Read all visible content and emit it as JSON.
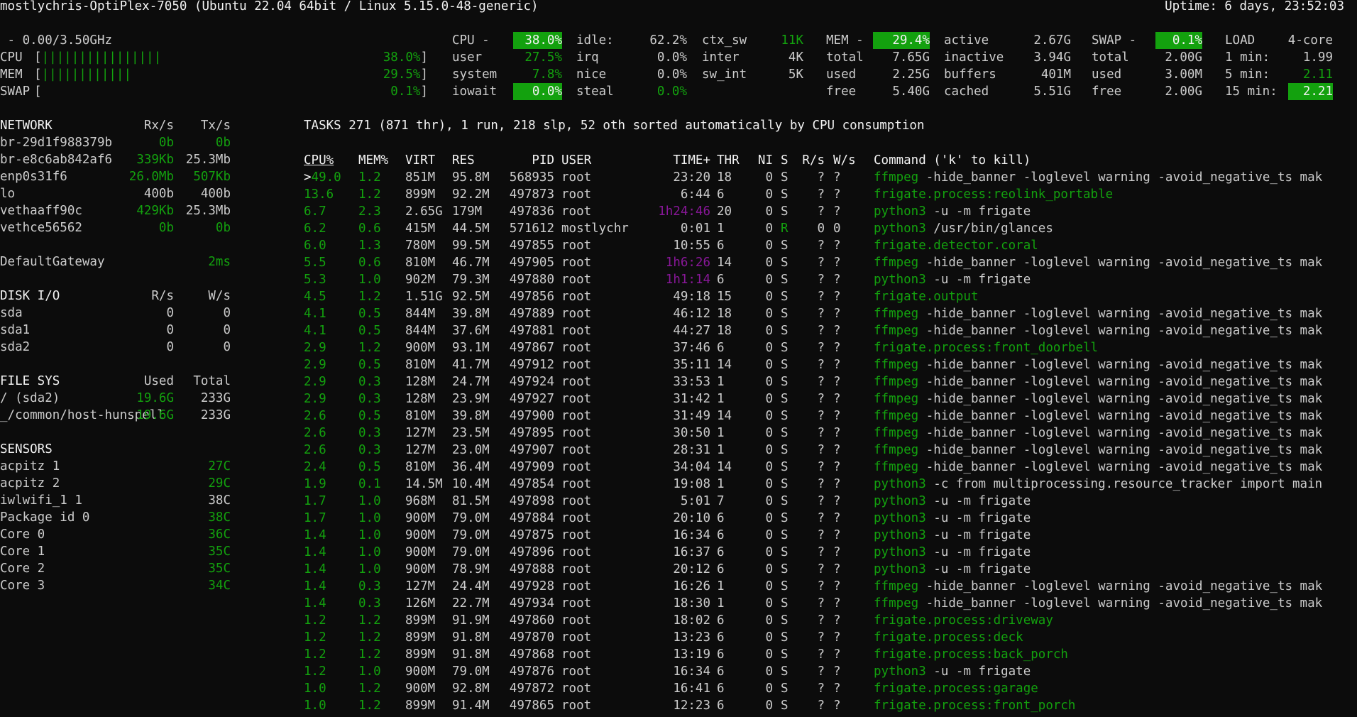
{
  "header": {
    "host": "mostlychris-OptiPlex-7050 (Ubuntu 22.04 64bit / Linux 5.15.0-48-generic)",
    "uptime": "Uptime: 6 days, 23:52:03"
  },
  "quicklook": {
    "freq": " - 0.00/3.50GHz",
    "cpu_label": "CPU",
    "cpu_bar": "[||||||||||||||||",
    "cpu_pct": "38.0%]",
    "mem_label": "MEM",
    "mem_bar": "[||||||||||||",
    "mem_pct": "29.5%]",
    "swap_label": "SWAP",
    "swap_bar": "[",
    "swap_pct": "0.1%]"
  },
  "cpu": {
    "title": "CPU -",
    "total": "38.0%",
    "rows": [
      {
        "k": "user",
        "v": "27.5%"
      },
      {
        "k": "system",
        "v": "7.8%"
      },
      {
        "k": "iowait",
        "v": "0.0%"
      }
    ],
    "rows2": [
      {
        "k": "idle:",
        "v": "62.2%"
      },
      {
        "k": "irq",
        "v": "0.0%"
      },
      {
        "k": "nice",
        "v": "0.0%"
      },
      {
        "k": "steal",
        "v": "0.0%"
      }
    ],
    "rows3": [
      {
        "k": "ctx_sw",
        "v": "11K"
      },
      {
        "k": "inter",
        "v": "4K"
      },
      {
        "k": "sw_int",
        "v": "5K"
      }
    ]
  },
  "mem": {
    "title": "MEM -",
    "total_pct": "29.4%",
    "rows": [
      {
        "k": "total",
        "v": "7.65G"
      },
      {
        "k": "used",
        "v": "2.25G"
      },
      {
        "k": "free",
        "v": "5.40G"
      }
    ],
    "rows2": [
      {
        "k": "active",
        "v": "2.67G"
      },
      {
        "k": "inactive",
        "v": "3.94G"
      },
      {
        "k": "buffers",
        "v": "401M"
      },
      {
        "k": "cached",
        "v": "5.51G"
      }
    ]
  },
  "swap": {
    "title": "SWAP -",
    "total_pct": "0.1%",
    "rows": [
      {
        "k": "total",
        "v": "2.00G"
      },
      {
        "k": "used",
        "v": "3.00M"
      },
      {
        "k": "free",
        "v": "2.00G"
      }
    ]
  },
  "load": {
    "title": "LOAD",
    "cores": "4-core",
    "rows": [
      {
        "k": "1 min:",
        "v": "1.99"
      },
      {
        "k": "5 min:",
        "v": "2.11"
      },
      {
        "k": "15 min:",
        "v": "2.21"
      }
    ]
  },
  "network": {
    "title": "NETWORK",
    "rx_h": "Rx/s",
    "tx_h": "Tx/s",
    "rows": [
      {
        "name": "br-29d1f988379b",
        "rx": "0b",
        "tx": "0b"
      },
      {
        "name": "br-e8c6ab842af6",
        "rx": "339Kb",
        "tx": "25.3Mb"
      },
      {
        "name": "enp0s31f6",
        "rx": "26.0Mb",
        "tx": "507Kb"
      },
      {
        "name": "lo",
        "rx": "400b",
        "tx": "400b"
      },
      {
        "name": "vethaaff90c",
        "rx": "429Kb",
        "tx": "25.3Mb"
      },
      {
        "name": "vethce56562",
        "rx": "0b",
        "tx": "0b"
      }
    ],
    "gateway_label": "DefaultGateway",
    "gateway_value": "2ms"
  },
  "diskio": {
    "title": "DISK I/O",
    "r_h": "R/s",
    "w_h": "W/s",
    "rows": [
      {
        "name": "sda",
        "r": "0",
        "w": "0"
      },
      {
        "name": "sda1",
        "r": "0",
        "w": "0"
      },
      {
        "name": "sda2",
        "r": "0",
        "w": "0"
      }
    ]
  },
  "fs": {
    "title": "FILE SYS",
    "used_h": "Used",
    "total_h": "Total",
    "rows": [
      {
        "name": "/ (sda2)",
        "used": "19.6G",
        "total": "233G"
      },
      {
        "name": "_/common/host-hunspell",
        "used": "19.6G",
        "total": "233G"
      }
    ]
  },
  "sensors": {
    "title": "SENSORS",
    "rows": [
      {
        "name": "acpitz 1",
        "v": "27C",
        "g": true
      },
      {
        "name": "acpitz 2",
        "v": "29C",
        "g": true
      },
      {
        "name": "iwlwifi_1 1",
        "v": "38C",
        "g": false
      },
      {
        "name": "Package id 0",
        "v": "38C",
        "g": true
      },
      {
        "name": "Core 0",
        "v": "36C",
        "g": true
      },
      {
        "name": "Core 1",
        "v": "35C",
        "g": true
      },
      {
        "name": "Core 2",
        "v": "35C",
        "g": true
      },
      {
        "name": "Core 3",
        "v": "34C",
        "g": true
      }
    ]
  },
  "tasks": {
    "summary": "TASKS 271 (871 thr), 1 run, 218 slp, 52 oth sorted automatically by CPU consumption",
    "headers": {
      "cpu": "CPU%",
      "mem": "MEM%",
      "virt": "VIRT",
      "res": "RES",
      "pid": "PID",
      "user": "USER",
      "time": "TIME+",
      "thr": "THR",
      "ni": "NI",
      "s": "S",
      "rs": "R/s",
      "ws": "W/s",
      "cmd": "Command ('k' to kill)"
    }
  },
  "processes": [
    {
      "cpu": ">49.0",
      "mem": "1.2",
      "virt": "851M",
      "res": "95.8M",
      "pid": "568935",
      "user": "root",
      "time": "23:20",
      "tm": false,
      "thr": "18",
      "ni": "0",
      "s": "S",
      "rs": "?",
      "ws": "?",
      "exe": "ffmpeg",
      "args": " -hide_banner -loglevel warning -avoid_negative_ts mak"
    },
    {
      "cpu": "13.6",
      "mem": "1.2",
      "virt": "899M",
      "res": "92.2M",
      "pid": "497873",
      "user": "root",
      "time": "6:44",
      "tm": false,
      "thr": "6",
      "ni": "0",
      "s": "S",
      "rs": "?",
      "ws": "?",
      "exe": "frigate.process:reolink_portable",
      "args": ""
    },
    {
      "cpu": "6.7",
      "mem": "2.3",
      "virt": "2.65G",
      "res": "179M",
      "pid": "497836",
      "user": "root",
      "time": "1h24:46",
      "tm": true,
      "thr": "20",
      "ni": "0",
      "s": "S",
      "rs": "?",
      "ws": "?",
      "exe": "python3",
      "args": " -u -m frigate"
    },
    {
      "cpu": "6.2",
      "mem": "0.6",
      "virt": "415M",
      "res": "44.5M",
      "pid": "571612",
      "user": "mostlychr",
      "time": "0:01",
      "tm": false,
      "thr": "1",
      "ni": "0",
      "s": "R",
      "rs": "0",
      "ws": "0",
      "exe": "python3",
      "args": " /usr/bin/glances"
    },
    {
      "cpu": "6.0",
      "mem": "1.3",
      "virt": "780M",
      "res": "99.5M",
      "pid": "497855",
      "user": "root",
      "time": "10:55",
      "tm": false,
      "thr": "6",
      "ni": "0",
      "s": "S",
      "rs": "?",
      "ws": "?",
      "exe": "frigate.detector.coral",
      "args": ""
    },
    {
      "cpu": "5.5",
      "mem": "0.6",
      "virt": "810M",
      "res": "46.7M",
      "pid": "497905",
      "user": "root",
      "time": "1h6:26",
      "tm": true,
      "thr": "14",
      "ni": "0",
      "s": "S",
      "rs": "?",
      "ws": "?",
      "exe": "ffmpeg",
      "args": " -hide_banner -loglevel warning -avoid_negative_ts mak"
    },
    {
      "cpu": "5.3",
      "mem": "1.0",
      "virt": "902M",
      "res": "79.3M",
      "pid": "497880",
      "user": "root",
      "time": "1h1:14",
      "tm": true,
      "thr": "6",
      "ni": "0",
      "s": "S",
      "rs": "?",
      "ws": "?",
      "exe": "python3",
      "args": " -u -m frigate"
    },
    {
      "cpu": "4.5",
      "mem": "1.2",
      "virt": "1.51G",
      "res": "92.5M",
      "pid": "497856",
      "user": "root",
      "time": "49:18",
      "tm": false,
      "thr": "15",
      "ni": "0",
      "s": "S",
      "rs": "?",
      "ws": "?",
      "exe": "frigate.output",
      "args": ""
    },
    {
      "cpu": "4.1",
      "mem": "0.5",
      "virt": "844M",
      "res": "39.8M",
      "pid": "497889",
      "user": "root",
      "time": "46:12",
      "tm": false,
      "thr": "18",
      "ni": "0",
      "s": "S",
      "rs": "?",
      "ws": "?",
      "exe": "ffmpeg",
      "args": " -hide_banner -loglevel warning -avoid_negative_ts mak"
    },
    {
      "cpu": "4.1",
      "mem": "0.5",
      "virt": "844M",
      "res": "37.6M",
      "pid": "497881",
      "user": "root",
      "time": "44:27",
      "tm": false,
      "thr": "18",
      "ni": "0",
      "s": "S",
      "rs": "?",
      "ws": "?",
      "exe": "ffmpeg",
      "args": " -hide_banner -loglevel warning -avoid_negative_ts mak"
    },
    {
      "cpu": "2.9",
      "mem": "1.2",
      "virt": "900M",
      "res": "93.1M",
      "pid": "497867",
      "user": "root",
      "time": "37:46",
      "tm": false,
      "thr": "6",
      "ni": "0",
      "s": "S",
      "rs": "?",
      "ws": "?",
      "exe": "frigate.process:front_doorbell",
      "args": ""
    },
    {
      "cpu": "2.9",
      "mem": "0.5",
      "virt": "810M",
      "res": "41.7M",
      "pid": "497912",
      "user": "root",
      "time": "35:11",
      "tm": false,
      "thr": "14",
      "ni": "0",
      "s": "S",
      "rs": "?",
      "ws": "?",
      "exe": "ffmpeg",
      "args": " -hide_banner -loglevel warning -avoid_negative_ts mak"
    },
    {
      "cpu": "2.9",
      "mem": "0.3",
      "virt": "128M",
      "res": "24.7M",
      "pid": "497924",
      "user": "root",
      "time": "33:53",
      "tm": false,
      "thr": "1",
      "ni": "0",
      "s": "S",
      "rs": "?",
      "ws": "?",
      "exe": "ffmpeg",
      "args": " -hide_banner -loglevel warning -avoid_negative_ts mak"
    },
    {
      "cpu": "2.9",
      "mem": "0.3",
      "virt": "128M",
      "res": "23.9M",
      "pid": "497927",
      "user": "root",
      "time": "31:42",
      "tm": false,
      "thr": "1",
      "ni": "0",
      "s": "S",
      "rs": "?",
      "ws": "?",
      "exe": "ffmpeg",
      "args": " -hide_banner -loglevel warning -avoid_negative_ts mak"
    },
    {
      "cpu": "2.6",
      "mem": "0.5",
      "virt": "810M",
      "res": "39.8M",
      "pid": "497900",
      "user": "root",
      "time": "31:49",
      "tm": false,
      "thr": "14",
      "ni": "0",
      "s": "S",
      "rs": "?",
      "ws": "?",
      "exe": "ffmpeg",
      "args": " -hide_banner -loglevel warning -avoid_negative_ts mak"
    },
    {
      "cpu": "2.6",
      "mem": "0.3",
      "virt": "127M",
      "res": "23.5M",
      "pid": "497895",
      "user": "root",
      "time": "30:50",
      "tm": false,
      "thr": "1",
      "ni": "0",
      "s": "S",
      "rs": "?",
      "ws": "?",
      "exe": "ffmpeg",
      "args": " -hide_banner -loglevel warning -avoid_negative_ts mak"
    },
    {
      "cpu": "2.6",
      "mem": "0.3",
      "virt": "127M",
      "res": "23.0M",
      "pid": "497907",
      "user": "root",
      "time": "28:31",
      "tm": false,
      "thr": "1",
      "ni": "0",
      "s": "S",
      "rs": "?",
      "ws": "?",
      "exe": "ffmpeg",
      "args": " -hide_banner -loglevel warning -avoid_negative_ts mak"
    },
    {
      "cpu": "2.4",
      "mem": "0.5",
      "virt": "810M",
      "res": "36.4M",
      "pid": "497909",
      "user": "root",
      "time": "34:04",
      "tm": false,
      "thr": "14",
      "ni": "0",
      "s": "S",
      "rs": "?",
      "ws": "?",
      "exe": "ffmpeg",
      "args": " -hide_banner -loglevel warning -avoid_negative_ts mak"
    },
    {
      "cpu": "1.9",
      "mem": "0.1",
      "virt": "14.5M",
      "res": "10.4M",
      "pid": "497854",
      "user": "root",
      "time": "19:08",
      "tm": false,
      "thr": "1",
      "ni": "0",
      "s": "S",
      "rs": "?",
      "ws": "?",
      "exe": "python3",
      "args": " -c from multiprocessing.resource_tracker import main"
    },
    {
      "cpu": "1.7",
      "mem": "1.0",
      "virt": "968M",
      "res": "81.5M",
      "pid": "497898",
      "user": "root",
      "time": "5:01",
      "tm": false,
      "thr": "7",
      "ni": "0",
      "s": "S",
      "rs": "?",
      "ws": "?",
      "exe": "python3",
      "args": " -u -m frigate"
    },
    {
      "cpu": "1.7",
      "mem": "1.0",
      "virt": "900M",
      "res": "79.0M",
      "pid": "497884",
      "user": "root",
      "time": "20:10",
      "tm": false,
      "thr": "6",
      "ni": "0",
      "s": "S",
      "rs": "?",
      "ws": "?",
      "exe": "python3",
      "args": " -u -m frigate"
    },
    {
      "cpu": "1.4",
      "mem": "1.0",
      "virt": "900M",
      "res": "79.0M",
      "pid": "497875",
      "user": "root",
      "time": "16:34",
      "tm": false,
      "thr": "6",
      "ni": "0",
      "s": "S",
      "rs": "?",
      "ws": "?",
      "exe": "python3",
      "args": " -u -m frigate"
    },
    {
      "cpu": "1.4",
      "mem": "1.0",
      "virt": "900M",
      "res": "79.0M",
      "pid": "497896",
      "user": "root",
      "time": "16:37",
      "tm": false,
      "thr": "6",
      "ni": "0",
      "s": "S",
      "rs": "?",
      "ws": "?",
      "exe": "python3",
      "args": " -u -m frigate"
    },
    {
      "cpu": "1.4",
      "mem": "1.0",
      "virt": "900M",
      "res": "78.9M",
      "pid": "497888",
      "user": "root",
      "time": "20:12",
      "tm": false,
      "thr": "6",
      "ni": "0",
      "s": "S",
      "rs": "?",
      "ws": "?",
      "exe": "python3",
      "args": " -u -m frigate"
    },
    {
      "cpu": "1.4",
      "mem": "0.3",
      "virt": "127M",
      "res": "24.4M",
      "pid": "497928",
      "user": "root",
      "time": "16:26",
      "tm": false,
      "thr": "1",
      "ni": "0",
      "s": "S",
      "rs": "?",
      "ws": "?",
      "exe": "ffmpeg",
      "args": " -hide_banner -loglevel warning -avoid_negative_ts mak"
    },
    {
      "cpu": "1.4",
      "mem": "0.3",
      "virt": "126M",
      "res": "22.7M",
      "pid": "497934",
      "user": "root",
      "time": "18:30",
      "tm": false,
      "thr": "1",
      "ni": "0",
      "s": "S",
      "rs": "?",
      "ws": "?",
      "exe": "ffmpeg",
      "args": " -hide_banner -loglevel warning -avoid_negative_ts mak"
    },
    {
      "cpu": "1.2",
      "mem": "1.2",
      "virt": "899M",
      "res": "91.9M",
      "pid": "497860",
      "user": "root",
      "time": "18:02",
      "tm": false,
      "thr": "6",
      "ni": "0",
      "s": "S",
      "rs": "?",
      "ws": "?",
      "exe": "frigate.process:driveway",
      "args": ""
    },
    {
      "cpu": "1.2",
      "mem": "1.2",
      "virt": "899M",
      "res": "91.8M",
      "pid": "497870",
      "user": "root",
      "time": "13:23",
      "tm": false,
      "thr": "6",
      "ni": "0",
      "s": "S",
      "rs": "?",
      "ws": "?",
      "exe": "frigate.process:deck",
      "args": ""
    },
    {
      "cpu": "1.2",
      "mem": "1.2",
      "virt": "899M",
      "res": "91.8M",
      "pid": "497868",
      "user": "root",
      "time": "13:19",
      "tm": false,
      "thr": "6",
      "ni": "0",
      "s": "S",
      "rs": "?",
      "ws": "?",
      "exe": "frigate.process:back_porch",
      "args": ""
    },
    {
      "cpu": "1.2",
      "mem": "1.0",
      "virt": "900M",
      "res": "79.0M",
      "pid": "497876",
      "user": "root",
      "time": "16:34",
      "tm": false,
      "thr": "6",
      "ni": "0",
      "s": "S",
      "rs": "?",
      "ws": "?",
      "exe": "python3",
      "args": " -u -m frigate"
    },
    {
      "cpu": "1.0",
      "mem": "1.2",
      "virt": "900M",
      "res": "92.8M",
      "pid": "497872",
      "user": "root",
      "time": "16:41",
      "tm": false,
      "thr": "6",
      "ni": "0",
      "s": "S",
      "rs": "?",
      "ws": "?",
      "exe": "frigate.process:garage",
      "args": ""
    },
    {
      "cpu": "1.0",
      "mem": "1.2",
      "virt": "899M",
      "res": "91.4M",
      "pid": "497865",
      "user": "root",
      "time": "12:23",
      "tm": false,
      "thr": "6",
      "ni": "0",
      "s": "S",
      "rs": "?",
      "ws": "?",
      "exe": "frigate.process:front_porch",
      "args": ""
    }
  ]
}
